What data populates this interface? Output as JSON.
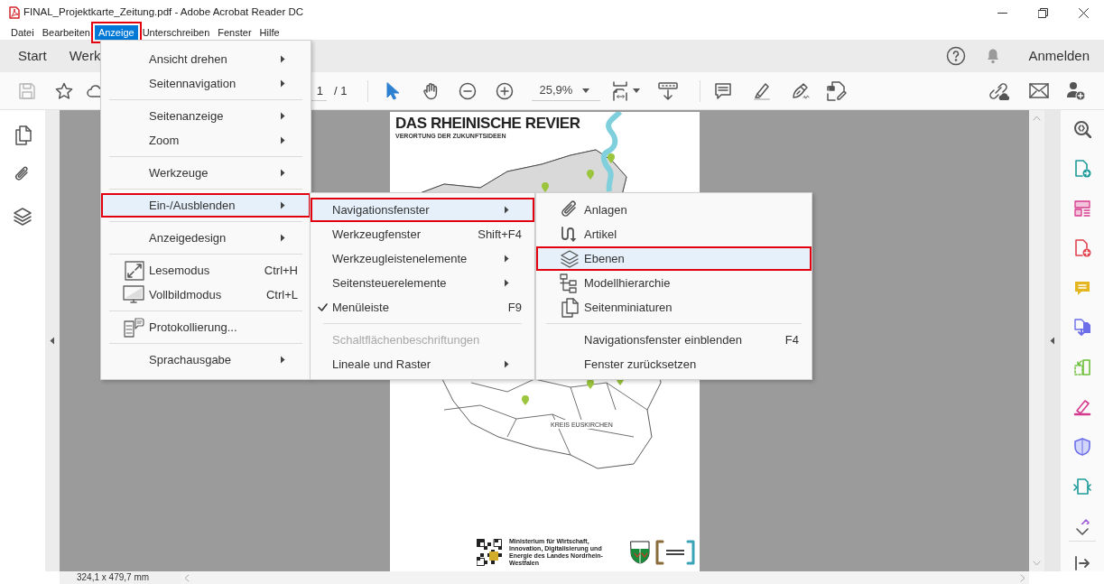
{
  "window": {
    "title": "FINAL_Projektkarte_Zeitung.pdf - Adobe Acrobat Reader DC"
  },
  "menu_bar": [
    {
      "label": "Datei",
      "selected": false,
      "marked": false
    },
    {
      "label": "Bearbeiten",
      "selected": false,
      "marked": false
    },
    {
      "label": "Anzeige",
      "selected": true,
      "marked": true
    },
    {
      "label": "Unterschreiben",
      "selected": false,
      "marked": false
    },
    {
      "label": "Fenster",
      "selected": false,
      "marked": false
    },
    {
      "label": "Hilfe",
      "selected": false,
      "marked": false
    }
  ],
  "tabs": [
    {
      "label": "Start"
    },
    {
      "label": "Werk"
    }
  ],
  "header": {
    "sign_in": "Anmelden"
  },
  "toolbar": {
    "page_number": "1",
    "page_count": "/ 1",
    "zoom": "25,9%"
  },
  "document": {
    "title": "DAS RHEINISCHE REVIER",
    "subtitle": "VERORTUNG DER ZUKUNFTSIDEEN",
    "map_label": "KREIS EUSKIRCHEN",
    "footer_text": "Ministerium für Wirtschaft, Innovation, Digitalisierung und Energie des Landes Nordrhein-Westfalen"
  },
  "status_bar": {
    "page_size": "324,1 x 479,7 mm"
  },
  "menus": [
    {
      "items": [
        {
          "kind": "item",
          "label": "Ansicht drehen",
          "submenu": true,
          "selected": false,
          "marked": false
        },
        {
          "kind": "item",
          "label": "Seitennavigation",
          "submenu": true,
          "selected": false,
          "marked": false
        },
        {
          "kind": "separator"
        },
        {
          "kind": "item",
          "label": "Seitenanzeige",
          "submenu": true,
          "selected": false,
          "marked": false
        },
        {
          "kind": "item",
          "label": "Zoom",
          "submenu": true,
          "selected": false,
          "marked": false
        },
        {
          "kind": "separator"
        },
        {
          "kind": "item",
          "label": "Werkzeuge",
          "submenu": true,
          "selected": false,
          "marked": false
        },
        {
          "kind": "separator"
        },
        {
          "kind": "item",
          "label": "Ein-/Ausblenden",
          "submenu": true,
          "selected": true,
          "marked": true
        },
        {
          "kind": "separator"
        },
        {
          "kind": "item",
          "label": "Anzeigedesign",
          "submenu": true,
          "selected": false,
          "marked": false
        },
        {
          "kind": "separator"
        },
        {
          "kind": "item",
          "label": "Lesemodus",
          "shortcut": "Ctrl+H",
          "submenu": false,
          "selected": false,
          "marked": false
        },
        {
          "kind": "item",
          "label": "Vollbildmodus",
          "shortcut": "Ctrl+L",
          "submenu": false,
          "selected": false,
          "marked": false
        },
        {
          "kind": "separator"
        },
        {
          "kind": "item",
          "label": "Protokollierung...",
          "submenu": false,
          "selected": false,
          "marked": false
        },
        {
          "kind": "separator"
        },
        {
          "kind": "item",
          "label": "Sprachausgabe",
          "submenu": true,
          "selected": false,
          "marked": false
        }
      ]
    },
    {
      "items": [
        {
          "kind": "item",
          "label": "Navigationsfenster",
          "submenu": true,
          "selected": true,
          "marked": true,
          "checked": false,
          "disabled": false
        },
        {
          "kind": "item",
          "label": "Werkzeugfenster",
          "shortcut": "Shift+F4",
          "submenu": false,
          "selected": false,
          "marked": false,
          "checked": false,
          "disabled": false
        },
        {
          "kind": "item",
          "label": "Werkzeugleistenelemente",
          "submenu": true,
          "selected": false,
          "marked": false,
          "checked": false,
          "disabled": false
        },
        {
          "kind": "item",
          "label": "Seitensteuerelemente",
          "submenu": true,
          "selected": false,
          "marked": false,
          "checked": false,
          "disabled": false
        },
        {
          "kind": "item",
          "label": "Menüleiste",
          "shortcut": "F9",
          "submenu": false,
          "selected": false,
          "marked": false,
          "checked": true,
          "disabled": false
        },
        {
          "kind": "separator"
        },
        {
          "kind": "item",
          "label": "Schaltflächenbeschriftungen",
          "submenu": false,
          "selected": false,
          "marked": false,
          "checked": false,
          "disabled": true
        },
        {
          "kind": "item",
          "label": "Lineale und Raster",
          "submenu": true,
          "selected": false,
          "marked": false,
          "checked": false,
          "disabled": false
        }
      ]
    },
    {
      "items": [
        {
          "kind": "item",
          "label": "Anlagen",
          "submenu": false,
          "selected": false,
          "marked": false
        },
        {
          "kind": "item",
          "label": "Artikel",
          "submenu": false,
          "selected": false,
          "marked": false
        },
        {
          "kind": "item",
          "label": "Ebenen",
          "submenu": false,
          "selected": true,
          "marked": true
        },
        {
          "kind": "item",
          "label": "Modellhierarchie",
          "submenu": false,
          "selected": false,
          "marked": false
        },
        {
          "kind": "item",
          "label": "Seitenminiaturen",
          "submenu": false,
          "selected": false,
          "marked": false
        },
        {
          "kind": "separator"
        },
        {
          "kind": "item",
          "label": "Navigationsfenster einblenden",
          "shortcut": "F4",
          "submenu": false,
          "selected": false,
          "marked": false
        },
        {
          "kind": "item",
          "label": "Fenster zurücksetzen",
          "submenu": false,
          "selected": false,
          "marked": false
        }
      ]
    }
  ]
}
